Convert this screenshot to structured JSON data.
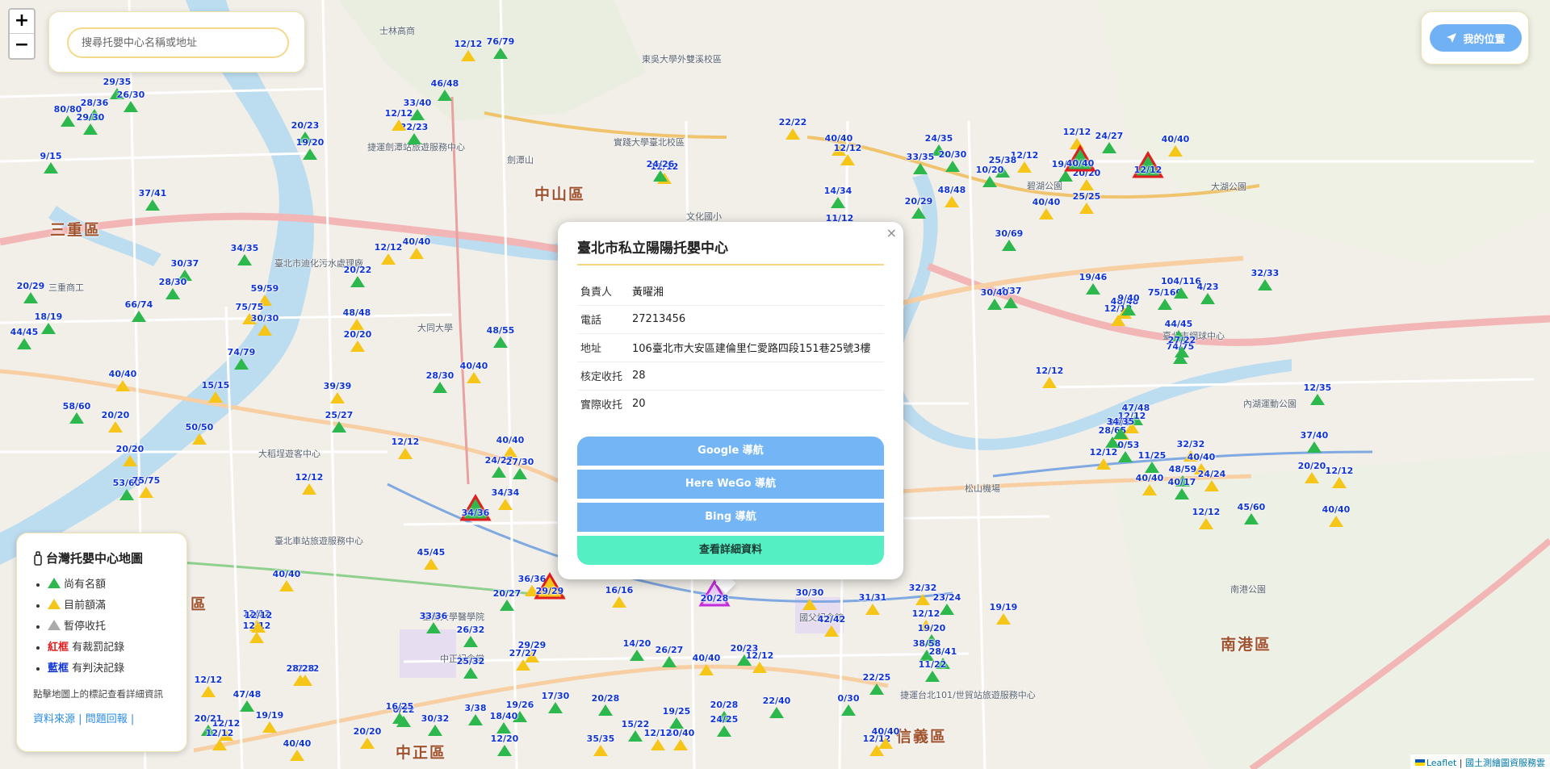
{
  "search": {
    "placeholder": "搜尋托嬰中心名稱或地址"
  },
  "zoom": {
    "in_label": "+",
    "out_label": "−"
  },
  "locate": {
    "label": "我的位置"
  },
  "districts": [
    {
      "name": "中山區"
    },
    {
      "name": "三重區"
    },
    {
      "name": "南港區"
    },
    {
      "name": "信義區"
    },
    {
      "name": "中正區"
    },
    {
      "name": "區"
    }
  ],
  "places": [
    {
      "name": "士林高商"
    },
    {
      "name": "東吳大學外雙溪校區"
    },
    {
      "name": "實踐大學臺北校區"
    },
    {
      "name": "劍潭山"
    },
    {
      "name": "捷運劍潭站旅遊服務中心"
    },
    {
      "name": "臺北市迪化污水處理廠"
    },
    {
      "name": "大同大學"
    },
    {
      "name": "大稻埕遊客中心"
    },
    {
      "name": "臺北車站旅遊服務中心"
    },
    {
      "name": "臺灣大學醫學院"
    },
    {
      "name": "中正紀念堂"
    },
    {
      "name": "國父紀念館"
    },
    {
      "name": "捷運台北101/世貿站旅遊服務中心"
    },
    {
      "name": "內湖運動公園"
    },
    {
      "name": "大湖公園"
    },
    {
      "name": "南港公園"
    },
    {
      "name": "臺北市網球中心"
    },
    {
      "name": "松山機場"
    },
    {
      "name": "三重商工"
    },
    {
      "name": "碧湖公園"
    },
    {
      "name": "文化國小"
    }
  ],
  "markers": [
    {
      "label": "12/12",
      "status": "full"
    },
    {
      "label": "76/79",
      "status": "ok"
    },
    {
      "label": "29/35",
      "status": "ok"
    },
    {
      "label": "26/30",
      "status": "ok"
    },
    {
      "label": "80/80",
      "status": "ok"
    },
    {
      "label": "28/36",
      "status": "ok"
    },
    {
      "label": "29/30",
      "status": "ok"
    },
    {
      "label": "9/15",
      "status": "ok"
    },
    {
      "label": "37/41",
      "status": "ok"
    },
    {
      "label": "20/23",
      "status": "ok"
    },
    {
      "label": "19/20",
      "status": "ok"
    },
    {
      "label": "33/40",
      "status": "ok"
    },
    {
      "label": "46/48",
      "status": "ok"
    },
    {
      "label": "22/23",
      "status": "ok"
    },
    {
      "label": "12/12",
      "status": "full"
    },
    {
      "label": "34/35",
      "status": "ok"
    },
    {
      "label": "40/40",
      "status": "full"
    },
    {
      "label": "12/12",
      "status": "full"
    },
    {
      "label": "30/37",
      "status": "ok"
    },
    {
      "label": "28/30",
      "status": "ok"
    },
    {
      "label": "20/22",
      "status": "ok"
    },
    {
      "label": "59/59",
      "status": "full"
    },
    {
      "label": "20/29",
      "status": "ok"
    },
    {
      "label": "66/74",
      "status": "ok"
    },
    {
      "label": "75/75",
      "status": "full"
    },
    {
      "label": "30/30",
      "status": "full"
    },
    {
      "label": "44/45",
      "status": "ok"
    },
    {
      "label": "18/19",
      "status": "ok"
    },
    {
      "label": "48/48",
      "status": "full"
    },
    {
      "label": "20/20",
      "status": "full"
    },
    {
      "label": "48/55",
      "status": "ok"
    },
    {
      "label": "74/79",
      "status": "ok"
    },
    {
      "label": "40/40",
      "status": "full"
    },
    {
      "label": "15/15",
      "status": "full"
    },
    {
      "label": "39/39",
      "status": "full"
    },
    {
      "label": "28/30",
      "status": "ok"
    },
    {
      "label": "40/40",
      "status": "full"
    },
    {
      "label": "58/60",
      "status": "ok"
    },
    {
      "label": "20/20",
      "status": "full"
    },
    {
      "label": "25/27",
      "status": "ok"
    },
    {
      "label": "50/50",
      "status": "full"
    },
    {
      "label": "20/20",
      "status": "full"
    },
    {
      "label": "12/12",
      "status": "full"
    },
    {
      "label": "40/40",
      "status": "full"
    },
    {
      "label": "24/27",
      "status": "ok"
    },
    {
      "label": "27/30",
      "status": "ok"
    },
    {
      "label": "34/34",
      "status": "full"
    },
    {
      "label": "53/60",
      "status": "ok"
    },
    {
      "label": "75/75",
      "status": "full"
    },
    {
      "label": "12/12",
      "status": "full"
    },
    {
      "label": "45/45",
      "status": "full"
    },
    {
      "label": "36/36",
      "status": "full"
    },
    {
      "label": "40/40",
      "status": "full"
    },
    {
      "label": "20/27",
      "status": "ok"
    },
    {
      "label": "16/16",
      "status": "full"
    },
    {
      "label": "33/36",
      "status": "ok"
    },
    {
      "label": "26/32",
      "status": "ok"
    },
    {
      "label": "29/29",
      "status": "full"
    },
    {
      "label": "12/12",
      "status": "full"
    },
    {
      "label": "25/32",
      "status": "ok"
    },
    {
      "label": "27/27",
      "status": "full"
    },
    {
      "label": "12/12",
      "status": "full"
    },
    {
      "label": "14/20",
      "status": "ok"
    },
    {
      "label": "26/27",
      "status": "ok"
    },
    {
      "label": "40/40",
      "status": "full"
    },
    {
      "label": "20/23",
      "status": "ok"
    },
    {
      "label": "12/12",
      "status": "full"
    },
    {
      "label": "30/30",
      "status": "full"
    },
    {
      "label": "31/31",
      "status": "full"
    },
    {
      "label": "42/42",
      "status": "full"
    },
    {
      "label": "32/32",
      "status": "full"
    },
    {
      "label": "23/24",
      "status": "ok"
    },
    {
      "label": "19/19",
      "status": "full"
    },
    {
      "label": "12/12",
      "status": "full"
    },
    {
      "label": "19/20",
      "status": "ok"
    },
    {
      "label": "38/58",
      "status": "ok"
    },
    {
      "label": "28/41",
      "status": "ok"
    },
    {
      "label": "11/22",
      "status": "ok"
    },
    {
      "label": "22/25",
      "status": "ok"
    },
    {
      "label": "0/30",
      "status": "ok"
    },
    {
      "label": "22/40",
      "status": "ok"
    },
    {
      "label": "40/40",
      "status": "full"
    },
    {
      "label": "12/12",
      "status": "full"
    },
    {
      "label": "20/28",
      "status": "ok"
    },
    {
      "label": "24/25",
      "status": "ok"
    },
    {
      "label": "19/25",
      "status": "ok"
    },
    {
      "label": "15/22",
      "status": "ok"
    },
    {
      "label": "12/12",
      "status": "full"
    },
    {
      "label": "35/35",
      "status": "full"
    },
    {
      "label": "12/20",
      "status": "ok"
    },
    {
      "label": "20/28",
      "status": "ok"
    },
    {
      "label": "17/30",
      "status": "ok"
    },
    {
      "label": "19/26",
      "status": "ok"
    },
    {
      "label": "18/40",
      "status": "ok"
    },
    {
      "label": "3/38",
      "status": "ok"
    },
    {
      "label": "0/22",
      "status": "ok"
    },
    {
      "label": "30/32",
      "status": "ok"
    },
    {
      "label": "16/25",
      "status": "ok"
    },
    {
      "label": "20/20",
      "status": "full"
    },
    {
      "label": "40/40",
      "status": "full"
    },
    {
      "label": "12/12",
      "status": "full"
    },
    {
      "label": "47/48",
      "status": "ok"
    },
    {
      "label": "20/21",
      "status": "ok"
    },
    {
      "label": "19/19",
      "status": "full"
    },
    {
      "label": "28/28",
      "status": "full"
    },
    {
      "label": "12/12",
      "status": "full"
    },
    {
      "label": "12/12",
      "status": "full"
    },
    {
      "label": "12/12",
      "status": "full"
    },
    {
      "label": "12/12",
      "status": "full"
    },
    {
      "label": "40/40",
      "status": "full"
    },
    {
      "label": "24/35",
      "status": "ok"
    },
    {
      "label": "40/40",
      "status": "full"
    },
    {
      "label": "33/35",
      "status": "ok"
    },
    {
      "label": "12/12",
      "status": "full"
    },
    {
      "label": "20/30",
      "status": "ok"
    },
    {
      "label": "48/48",
      "status": "full"
    },
    {
      "label": "20/29",
      "status": "ok"
    },
    {
      "label": "30/69",
      "status": "ok"
    },
    {
      "label": "25/25",
      "status": "full"
    },
    {
      "label": "12/12",
      "status": "full"
    },
    {
      "label": "25/38",
      "status": "ok"
    },
    {
      "label": "40/40",
      "status": "full"
    },
    {
      "label": "10/20",
      "status": "ok"
    },
    {
      "label": "19/40",
      "status": "ok"
    },
    {
      "label": "24/27",
      "status": "ok"
    },
    {
      "label": "20/20",
      "status": "full"
    },
    {
      "label": "12/12",
      "status": "full"
    },
    {
      "label": "40/40",
      "status": "full"
    },
    {
      "label": "22/22",
      "status": "full"
    },
    {
      "label": "12/12",
      "status": "full"
    },
    {
      "label": "24/26",
      "status": "ok"
    },
    {
      "label": "14/34",
      "status": "ok"
    },
    {
      "label": "11/12",
      "status": "ok"
    },
    {
      "label": "24/35",
      "status": "ok"
    },
    {
      "label": "12/12",
      "status": "full"
    },
    {
      "label": "4/37",
      "status": "ok"
    },
    {
      "label": "30/40",
      "status": "ok"
    },
    {
      "label": "32/33",
      "status": "ok"
    },
    {
      "label": "19/46",
      "status": "ok"
    },
    {
      "label": "12/12",
      "status": "full"
    },
    {
      "label": "75/160",
      "status": "ok"
    },
    {
      "label": "48/48",
      "status": "full"
    },
    {
      "label": "9/40",
      "status": "ok"
    },
    {
      "label": "44/45",
      "status": "ok"
    },
    {
      "label": "74/75",
      "status": "ok"
    },
    {
      "label": "104/116",
      "status": "ok"
    },
    {
      "label": "4/23",
      "status": "ok"
    },
    {
      "label": "27/22",
      "status": "ok"
    },
    {
      "label": "33/33",
      "status": "full"
    },
    {
      "label": "47/48",
      "status": "ok"
    },
    {
      "label": "12/12",
      "status": "full"
    },
    {
      "label": "40/53",
      "status": "ok"
    },
    {
      "label": "28/65",
      "status": "ok"
    },
    {
      "label": "12/12",
      "status": "full"
    },
    {
      "label": "34/35",
      "status": "ok"
    },
    {
      "label": "48/59",
      "status": "ok"
    },
    {
      "label": "32/32",
      "status": "full"
    },
    {
      "label": "12/12",
      "status": "full"
    },
    {
      "label": "40/40",
      "status": "full"
    },
    {
      "label": "11/25",
      "status": "ok"
    },
    {
      "label": "40/17",
      "status": "ok"
    },
    {
      "label": "12/12",
      "status": "full"
    },
    {
      "label": "45/60",
      "status": "ok"
    },
    {
      "label": "40/40",
      "status": "full"
    },
    {
      "label": "24/24",
      "status": "full"
    },
    {
      "label": "12/35",
      "status": "ok"
    },
    {
      "label": "20/20",
      "status": "full"
    },
    {
      "label": "37/40",
      "status": "ok"
    },
    {
      "label": "12/12",
      "status": "full"
    },
    {
      "label": "40/40",
      "status": "full"
    }
  ],
  "special_markers": [
    {
      "label": "34/36",
      "status": "red"
    },
    {
      "label": "29/29",
      "status": "red-yellow"
    },
    {
      "label": "20/28",
      "status": "selected"
    },
    {
      "label": "40/40",
      "status": "red"
    },
    {
      "label": "12/12",
      "status": "red"
    }
  ],
  "popup": {
    "title": "臺北市私立陽陽托嬰中心",
    "close": "×",
    "rows": [
      {
        "key": "負責人",
        "value": "黃曜湘"
      },
      {
        "key": "電話",
        "value": "27213456"
      },
      {
        "key": "地址",
        "value": "106臺北市大安區建倫里仁愛路四段151巷25號3樓"
      },
      {
        "key": "核定收托",
        "value": "28"
      },
      {
        "key": "實際收托",
        "value": "20"
      }
    ],
    "buttons": {
      "google": "Google 導航",
      "herewego": "Here WeGo 導航",
      "bing": "Bing 導航",
      "details": "查看詳細資料"
    }
  },
  "legend": {
    "title": "台灣托嬰中心地圖",
    "items": [
      {
        "text": "尚有名額"
      },
      {
        "text": "目前額滿"
      },
      {
        "text": "暫停收托"
      },
      {
        "em": "紅框",
        "text": "有裁罰記錄"
      },
      {
        "em": "藍框",
        "text": "有判決記錄"
      }
    ],
    "hint": "點擊地圖上的標記查看詳細資訊",
    "link_source": "資料來源",
    "link_report": "問題回報",
    "sep": "|"
  },
  "attribution": {
    "leaflet": "Leaflet",
    "sep": "|",
    "provider": "國土測繪圖資服務雲"
  },
  "colors": {
    "available": "#2db84d",
    "full": "#f5c518",
    "paused": "#aaaaaa",
    "count_text": "#1034d6",
    "penalty": "#e01e1e",
    "selected": "#c42bdd"
  }
}
